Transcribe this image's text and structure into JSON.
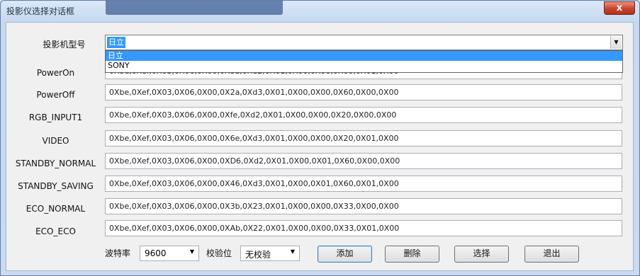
{
  "window": {
    "title": "投影仪选择对话框",
    "close_label": "x"
  },
  "projector_model": {
    "label": "投影机型号",
    "selected": "日立",
    "options": [
      "日立",
      "SONY"
    ]
  },
  "commands": [
    {
      "label": "PowerOn",
      "value": "0Xbe,0Xef,0X03,0X06,0X00,0Xba,0Xd2,0X01,0X00,0X00,0X60,0X01,0X00"
    },
    {
      "label": "PowerOff",
      "value": "0Xbe,0Xef,0X03,0X06,0X00,0X2a,0Xd3,0X01,0X00,0X00,0X60,0X00,0X00"
    },
    {
      "label": "RGB_INPUT1",
      "value": "0Xbe,0Xef,0X03,0X06,0X00,0Xfe,0Xd2,0X01,0X00,0X00,0X20,0X00,0X00"
    },
    {
      "label": "VIDEO",
      "value": "0Xbe,0Xef,0X03,0X06,0X00,0X6e,0Xd3,0X01,0X00,0X00,0X20,0X01,0X00"
    },
    {
      "label": "STANDBY_NORMAL",
      "value": "0Xbe,0Xef,0X03,0X06,0X00,0XD6,0Xd2,0X01,0X00,0X01,0X60,0X00,0X00"
    },
    {
      "label": "STANDBY_SAVING",
      "value": "0Xbe,0Xef,0X03,0X06,0X00,0X46,0Xd3,0X01,0X00,0X01,0X60,0X01,0X00"
    },
    {
      "label": "ECO_NORMAL",
      "value": "0Xbe,0Xef,0X03,0X06,0X00,0X3b,0X23,0X01,0X00,0X00,0X33,0X00,0X00"
    },
    {
      "label": "ECO_ECO",
      "value": "0Xbe,0Xef,0X03,0X06,0X00,0XAb,0X22,0X01,0X00,0X00,0X33,0X01,0X00"
    }
  ],
  "serial": {
    "baud_label": "波特率",
    "baud_value": "9600",
    "parity_label": "校验位",
    "parity_value": "无校验"
  },
  "buttons": {
    "add": "添加",
    "delete": "删除",
    "select": "选择",
    "exit": "退出"
  }
}
